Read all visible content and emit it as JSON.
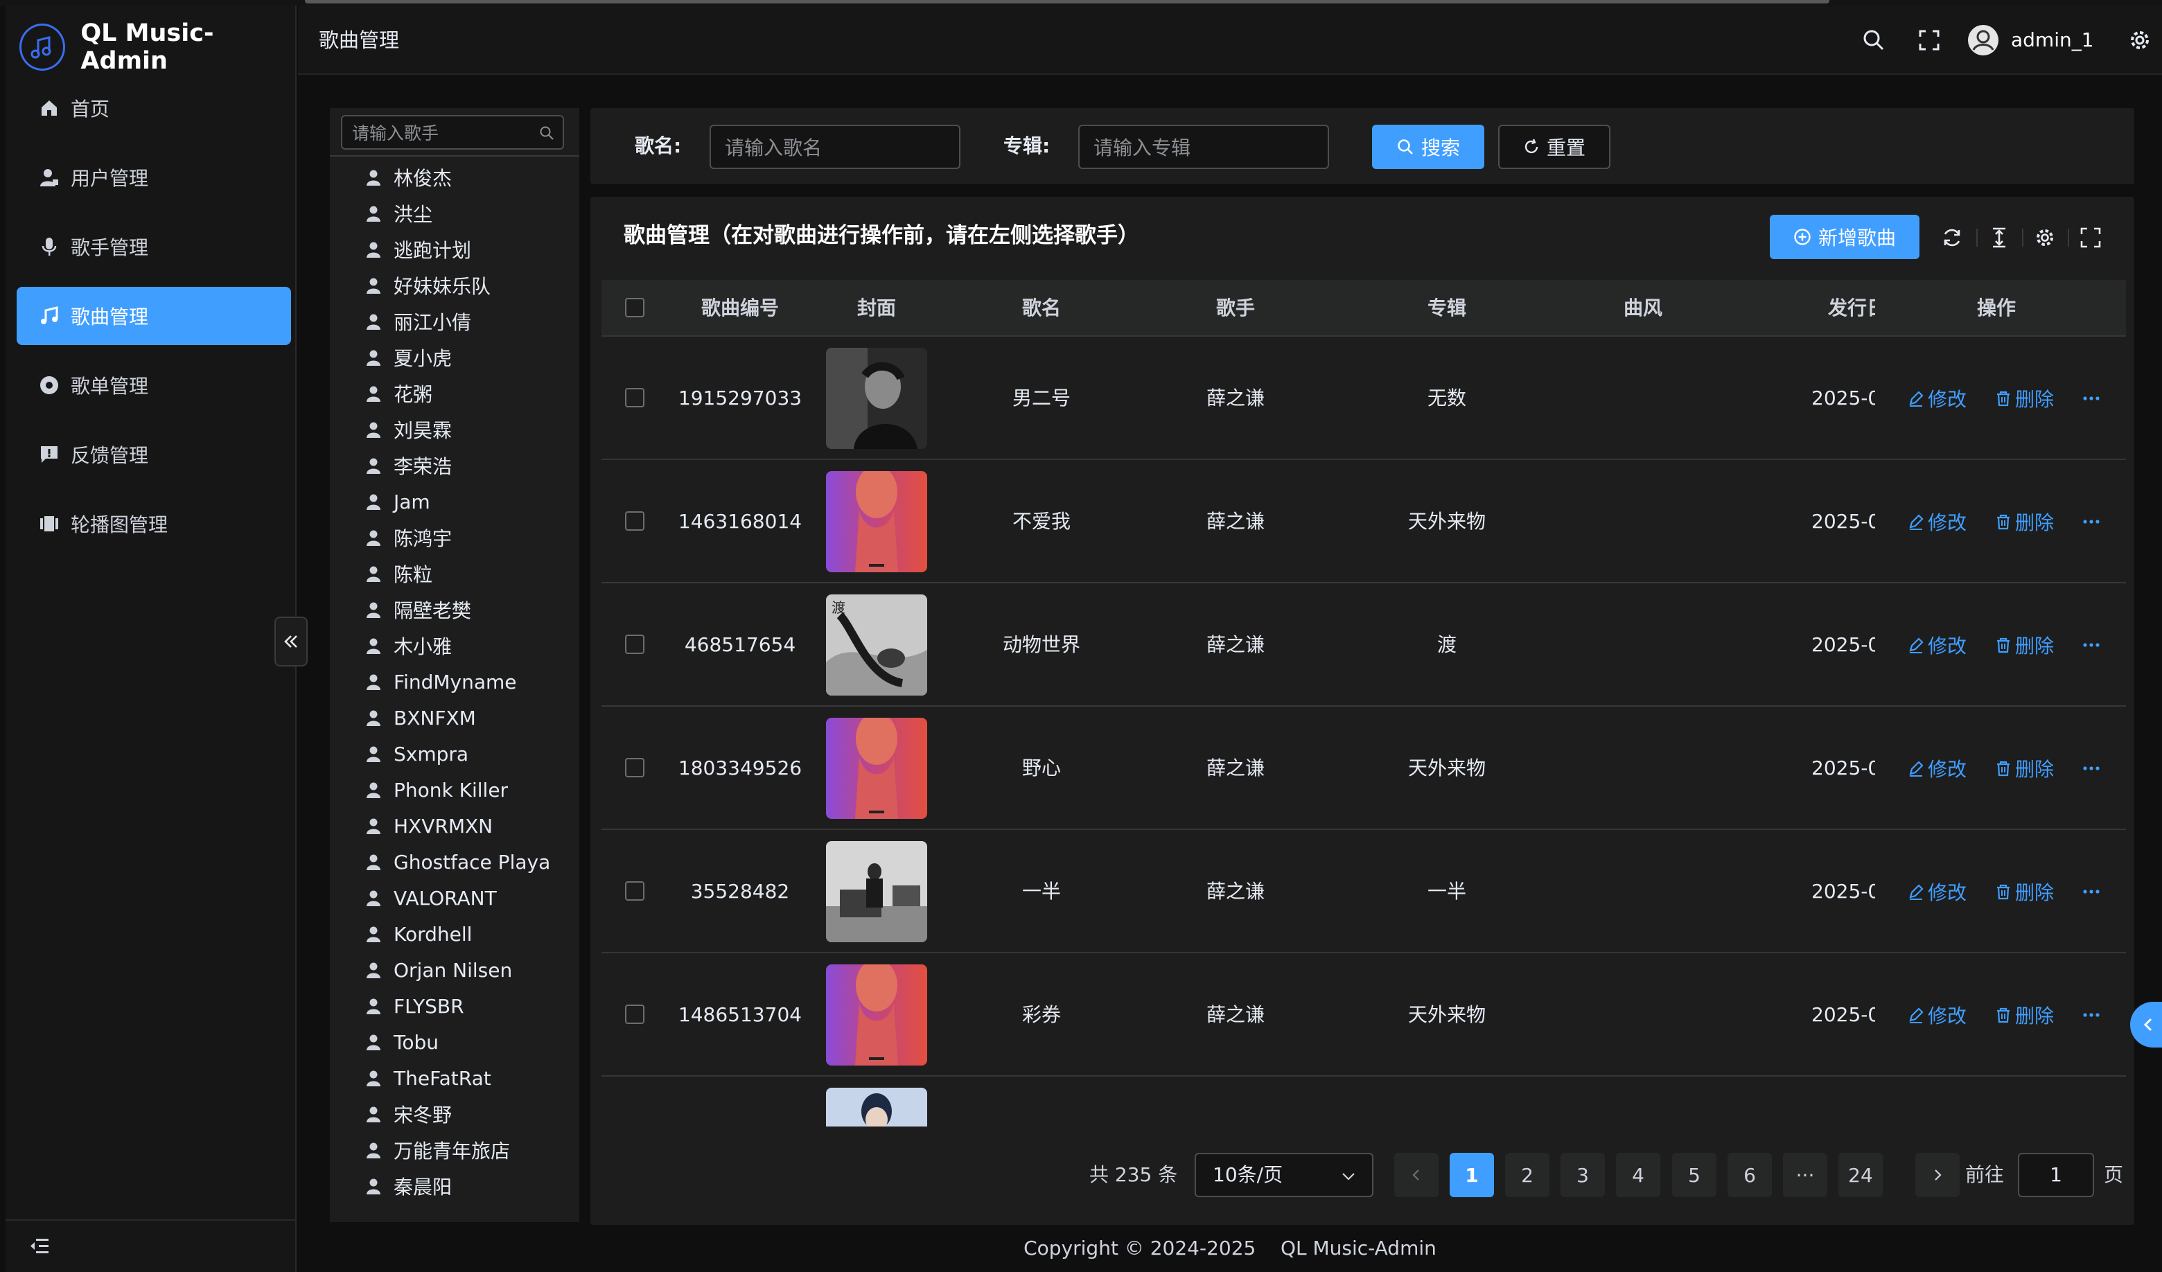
{
  "app": {
    "title": "QL Music-Admin"
  },
  "sidebar": {
    "items": [
      {
        "label": "首页",
        "icon": "home-icon"
      },
      {
        "label": "用户管理",
        "icon": "user-manage-icon"
      },
      {
        "label": "歌手管理",
        "icon": "microphone-icon"
      },
      {
        "label": "歌曲管理",
        "icon": "music-note-icon",
        "active": true
      },
      {
        "label": "歌单管理",
        "icon": "disc-icon"
      },
      {
        "label": "反馈管理",
        "icon": "feedback-icon"
      },
      {
        "label": "轮播图管理",
        "icon": "carousel-icon"
      }
    ]
  },
  "header": {
    "breadcrumb": "歌曲管理",
    "username": "admin_1"
  },
  "singer_panel": {
    "search_placeholder": "请输入歌手",
    "singers": [
      "林俊杰",
      "洪尘",
      "逃跑计划",
      "好妹妹乐队",
      "丽江小倩",
      "夏小虎",
      "花粥",
      "刘昊霖",
      "李荣浩",
      "Jam",
      "陈鸿宇",
      "陈粒",
      "隔壁老樊",
      "木小雅",
      "FindMyname",
      "BXNFXM",
      "Sxmpra",
      "Phonk Killer",
      "HXVRMXN",
      "Ghostface Playa",
      "VALORANT",
      "Kordhell",
      "Orjan Nilsen",
      "FLYSBR",
      "Tobu",
      "TheFatRat",
      "宋冬野",
      "万能青年旅店",
      "秦晨阳"
    ]
  },
  "search": {
    "song_label": "歌名:",
    "song_placeholder": "请输入歌名",
    "album_label": "专辑:",
    "album_placeholder": "请输入专辑",
    "search_button": "搜索",
    "reset_button": "重置"
  },
  "table": {
    "title": "歌曲管理（在对歌曲进行操作前，请在左侧选择歌手）",
    "add_button": "新增歌曲",
    "columns": [
      "歌曲编号",
      "封面",
      "歌名",
      "歌手",
      "专辑",
      "曲风",
      "发行日",
      "操作"
    ],
    "edit_label": "修改",
    "delete_label": "删除",
    "rows": [
      {
        "id": "1915297033",
        "name": "男二号",
        "singer": "薛之谦",
        "album": "无数",
        "style": "",
        "date": "2025-0",
        "cover": "bw-portrait"
      },
      {
        "id": "1463168014",
        "name": "不爱我",
        "singer": "薛之谦",
        "album": "天外来物",
        "style": "",
        "date": "2025-0",
        "cover": "red-blue"
      },
      {
        "id": "468517654",
        "name": "动物世界",
        "singer": "薛之谦",
        "album": "渡",
        "style": "",
        "date": "2025-0",
        "cover": "gray-wave"
      },
      {
        "id": "1803349526",
        "name": "野心",
        "singer": "薛之谦",
        "album": "天外来物",
        "style": "",
        "date": "2025-0",
        "cover": "red-blue"
      },
      {
        "id": "35528482",
        "name": "一半",
        "singer": "薛之谦",
        "album": "一半",
        "style": "",
        "date": "2025-0",
        "cover": "room"
      },
      {
        "id": "1486513704",
        "name": "彩券",
        "singer": "薛之谦",
        "album": "天外来物",
        "style": "",
        "date": "2025-0",
        "cover": "red-blue"
      },
      {
        "id": "",
        "name": "",
        "singer": "",
        "album": "",
        "style": "",
        "date": "",
        "cover": "partial"
      }
    ]
  },
  "pagination": {
    "total": "共 235 条",
    "page_size": "10条/页",
    "pages": [
      "1",
      "2",
      "3",
      "4",
      "5",
      "6",
      "···",
      "24"
    ],
    "current": "1",
    "goto_label": "前往",
    "goto_value": "1",
    "page_suffix": "页"
  },
  "footer": {
    "copyright": "Copyright © 2024-2025",
    "brand": "QL Music-Admin"
  },
  "colors": {
    "accent": "#409eff",
    "background": "#0f0f10",
    "card": "#1d1d1d"
  }
}
